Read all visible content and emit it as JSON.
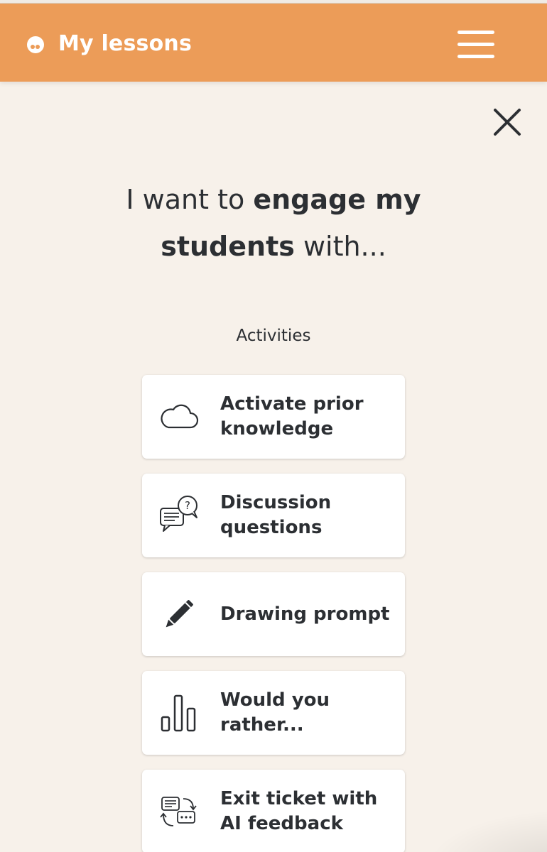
{
  "header": {
    "title": "My lessons",
    "logo_icon": "logo-icon",
    "menu_icon": "hamburger-menu-icon",
    "background_color": "#ec9c58"
  },
  "dialog": {
    "close_icon": "close-icon",
    "headline": {
      "part1": "I want to ",
      "bold1": "engage my",
      "bold2": "students",
      "part2": " with..."
    },
    "section_label": "Activities",
    "activities": [
      {
        "label": "Activate prior knowledge",
        "icon": "cloud-icon"
      },
      {
        "label": "Discussion questions",
        "icon": "chat-question-icon"
      },
      {
        "label": "Drawing prompt",
        "icon": "pencil-icon"
      },
      {
        "label": "Would you rather...",
        "icon": "bar-chart-icon"
      },
      {
        "label": "Exit ticket with AI feedback",
        "icon": "chat-exchange-icon"
      }
    ]
  },
  "colors": {
    "page_background": "#f7f1ea",
    "card_background": "#ffffff",
    "text": "#2c2f33"
  }
}
